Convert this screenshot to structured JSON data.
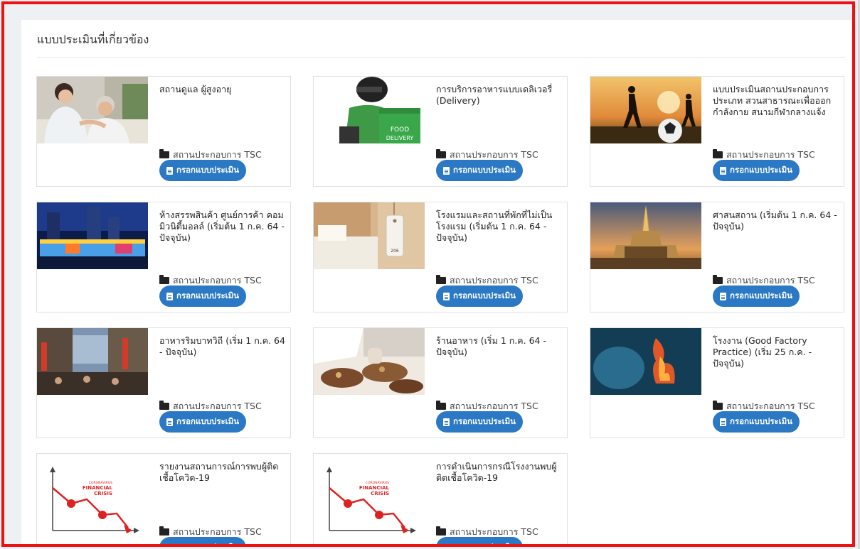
{
  "panel": {
    "title": "แบบประเมินที่เกี่ยวข้อง"
  },
  "cards": [
    {
      "title": "สถานดูแล ผู้สูงอายุ",
      "meta": "สถานประกอบการ TSC",
      "button": "กรอกแบบประเมิน"
    },
    {
      "title": "การบริการอาหารแบบเดลิเวอรี่ (Delivery)",
      "meta": "สถานประกอบการ TSC",
      "button": "กรอกแบบประเมิน",
      "image_text": "FOOD DELIVERY"
    },
    {
      "title": "แบบประเมินสถานประกอบการ ประเภท สวนสาธารณะเพื่อออก กำลังกาย สนามกีฬากลางแจ้ง",
      "meta": "สถานประกอบการ TSC",
      "button": "กรอกแบบประเมิน"
    },
    {
      "title": "ห้างสรรพสินค้า ศูนย์การค้า คอมมิวนิตี้มอลล์ (เริ่มต้น 1 ก.ค. 64 - ปัจจุบัน)",
      "meta": "สถานประกอบการ TSC",
      "button": "กรอกแบบประเมิน"
    },
    {
      "title": "โรงแรมและสถานที่พักที่ไม่เป็น โรงแรม (เริ่มต้น 1 ก.ค. 64 - ปัจจุบัน)",
      "meta": "สถานประกอบการ TSC",
      "button": "กรอกแบบประเมิน",
      "image_text": "206"
    },
    {
      "title": "ศาสนสถาน (เริ่มต้น 1 ก.ค. 64 - ปัจจุบัน)",
      "meta": "สถานประกอบการ TSC",
      "button": "กรอกแบบประเมิน"
    },
    {
      "title": "อาหารริมบาทวิถี (เริ่ม 1 ก.ค. 64 - ปัจจุบัน)",
      "meta": "สถานประกอบการ TSC",
      "button": "กรอกแบบประเมิน"
    },
    {
      "title": "ร้านอาหาร (เริ่ม 1 ก.ค. 64 - ปัจจุบัน)",
      "meta": "สถานประกอบการ TSC",
      "button": "กรอกแบบประเมิน"
    },
    {
      "title": "โรงงาน (Good Factory Practice) (เริ่ม 25 ก.ค. - ปัจจุบัน)",
      "meta": "สถานประกอบการ TSC",
      "button": "กรอกแบบประเมิน"
    },
    {
      "title": "รายงานสถานการณ์การพบผู้ติด เชื้อโควิด-19",
      "meta": "สถานประกอบการ TSC",
      "button": "กรอกแบบประเมิน",
      "image_text": [
        "CORONAVIRUS",
        "FINANCIAL",
        "CRISIS"
      ]
    },
    {
      "title": "การดำเนินการกรณีโรงงานพบผู้ ติดเชื้อโควิด-19",
      "meta": "สถานประกอบการ TSC",
      "button": "กรอกแบบประเมิน",
      "image_text": [
        "CORONAVIRUS",
        "FINANCIAL",
        "CRISIS"
      ]
    }
  ],
  "colors": {
    "frame": "#ee1111",
    "button": "#2b78c4",
    "background": "#eef0f3"
  }
}
